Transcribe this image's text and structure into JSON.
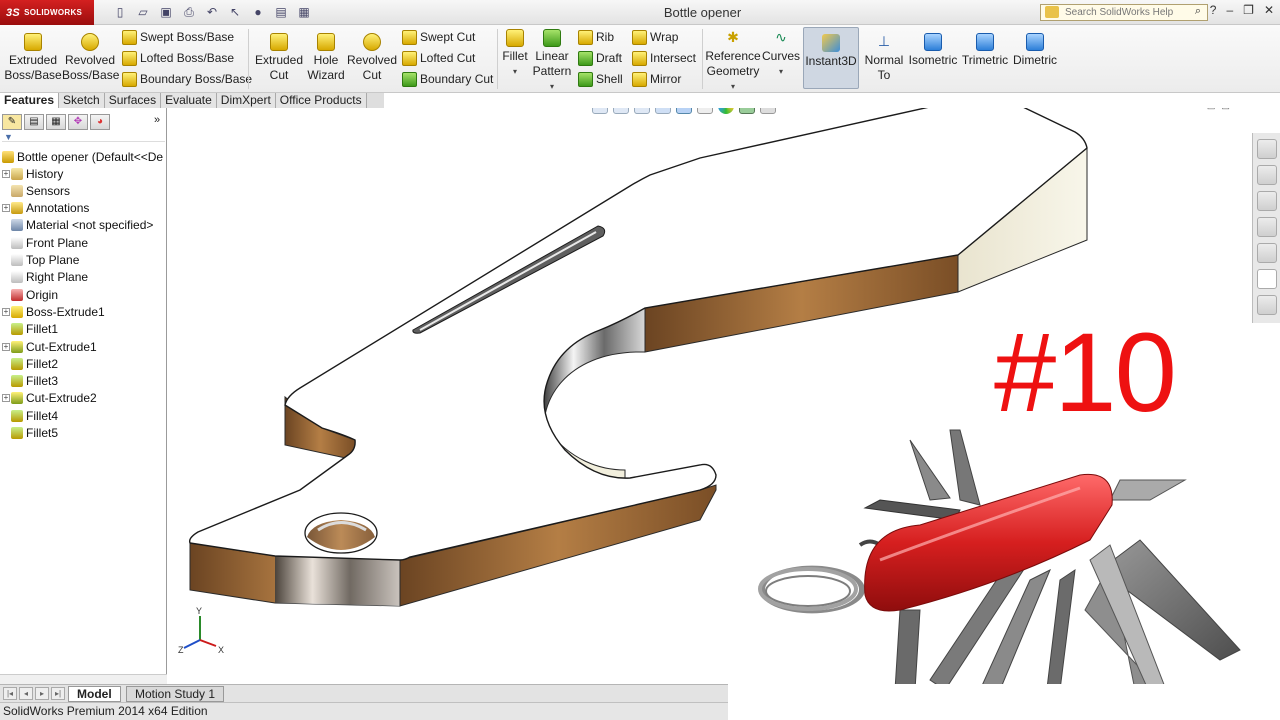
{
  "titlebar": {
    "brand": "SOLIDWORKS",
    "document_title": "Bottle opener",
    "search_placeholder": "Search SolidWorks Help",
    "help_glyph": "?"
  },
  "ribbon": {
    "extruded_boss": "Extruded Boss/Base",
    "revolved_boss": "Revolved Boss/Base",
    "swept_boss": "Swept Boss/Base",
    "lofted_boss": "Lofted Boss/Base",
    "boundary_boss": "Boundary Boss/Base",
    "extruded_cut": "Extruded Cut",
    "hole_wizard": "Hole Wizard",
    "revolved_cut": "Revolved Cut",
    "swept_cut": "Swept Cut",
    "lofted_cut": "Lofted Cut",
    "boundary_cut": "Boundary Cut",
    "fillet": "Fillet",
    "linear_pattern": "Linear Pattern",
    "rib": "Rib",
    "draft": "Draft",
    "shell": "Shell",
    "wrap": "Wrap",
    "intersect": "Intersect",
    "mirror": "Mirror",
    "reference_geometry": "Reference Geometry",
    "curves": "Curves",
    "instant3d": "Instant3D",
    "normal_to": "Normal To",
    "isometric": "Isometric",
    "trimetric": "Trimetric",
    "dimetric": "Dimetric"
  },
  "command_tabs": [
    "Features",
    "Sketch",
    "Surfaces",
    "Evaluate",
    "DimXpert",
    "Office Products"
  ],
  "feature_tree": {
    "root": "Bottle opener  (Default<<De",
    "items": [
      {
        "label": "History",
        "icon": "history-icon",
        "expand": true
      },
      {
        "label": "Sensors",
        "icon": "sensors-icon",
        "expand": false
      },
      {
        "label": "Annotations",
        "icon": "annotations-icon",
        "expand": true
      },
      {
        "label": "Material <not specified>",
        "icon": "material-icon",
        "expand": false
      },
      {
        "label": "Front Plane",
        "icon": "plane-icon",
        "expand": false
      },
      {
        "label": "Top Plane",
        "icon": "plane-icon",
        "expand": false
      },
      {
        "label": "Right Plane",
        "icon": "plane-icon",
        "expand": false
      },
      {
        "label": "Origin",
        "icon": "origin-icon",
        "expand": false
      },
      {
        "label": "Boss-Extrude1",
        "icon": "extrude-icon",
        "expand": true
      },
      {
        "label": "Fillet1",
        "icon": "fillet-icon",
        "expand": false
      },
      {
        "label": "Cut-Extrude1",
        "icon": "cut-extrude-icon",
        "expand": true
      },
      {
        "label": "Fillet2",
        "icon": "fillet-icon",
        "expand": false
      },
      {
        "label": "Fillet3",
        "icon": "fillet-icon",
        "expand": false
      },
      {
        "label": "Cut-Extrude2",
        "icon": "cut-extrude-icon",
        "expand": true
      },
      {
        "label": "Fillet4",
        "icon": "fillet-icon",
        "expand": false
      },
      {
        "label": "Fillet5",
        "icon": "fillet-icon",
        "expand": false
      }
    ]
  },
  "overlay": {
    "episode_number": "#10"
  },
  "triad": {
    "x": "X",
    "y": "Y",
    "z": "Z"
  },
  "bottom_tabs": [
    "Model",
    "Motion Study 1"
  ],
  "status": "SolidWorks Premium 2014 x64 Edition",
  "colors": {
    "brand_red": "#c41a1a",
    "overlay_red": "#ee1111",
    "knife_red": "#d61f1f",
    "bronze": "#8a5a2b"
  }
}
